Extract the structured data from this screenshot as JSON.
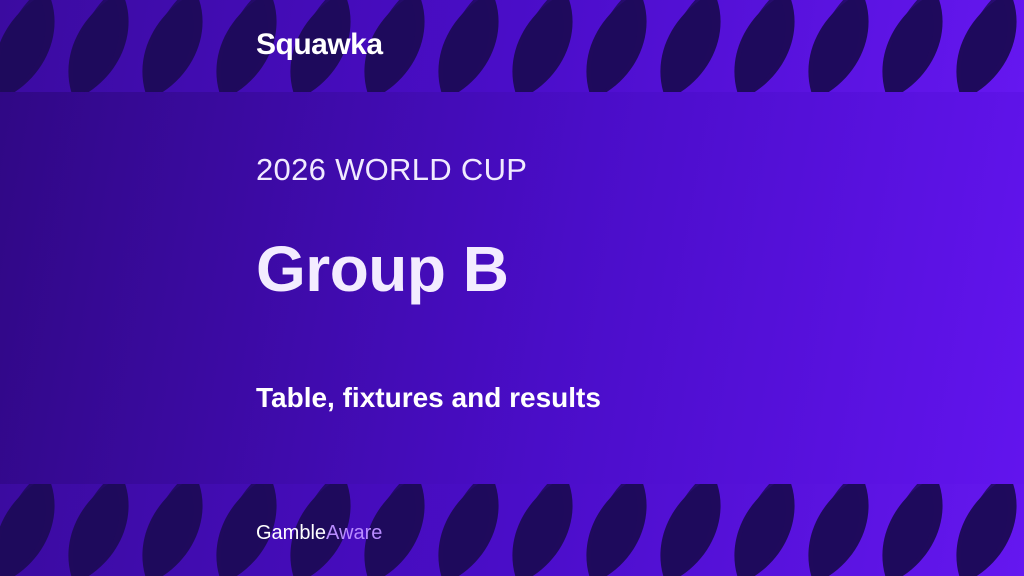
{
  "brand": {
    "name": "Squawka"
  },
  "hero": {
    "eyebrow": "2026 WORLD CUP",
    "title": "Group B",
    "subtitle": "Table, fixtures and results"
  },
  "footer": {
    "logo_part1": "Gamble",
    "logo_part2": "Aware"
  },
  "colors": {
    "background_dark": "#300885",
    "background_light": "#6214ee",
    "pattern": "#1f0a5c",
    "text": "#ffffff",
    "aware_accent": "#b98cff"
  }
}
